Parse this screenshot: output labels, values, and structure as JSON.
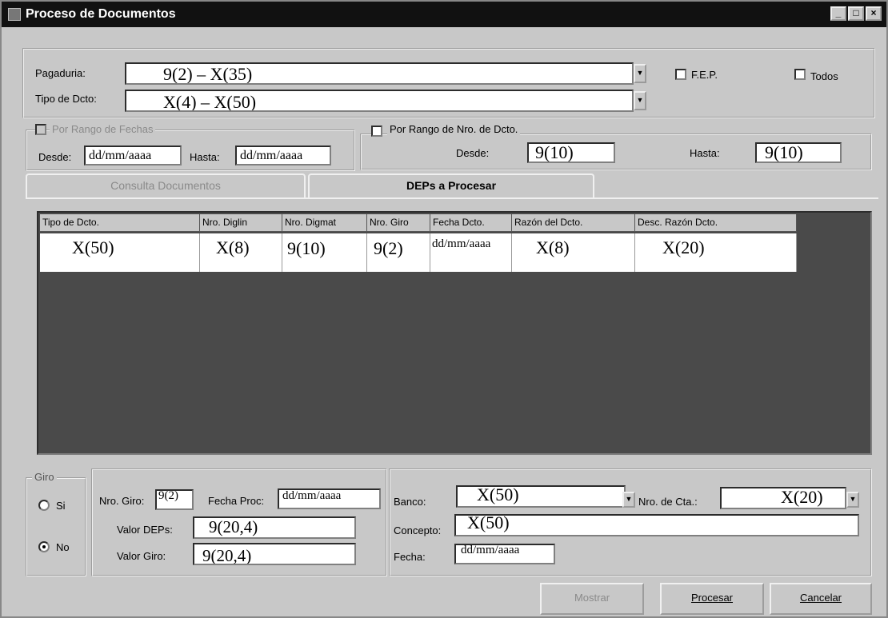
{
  "window": {
    "title": "Proceso de Documentos"
  },
  "header": {
    "pagaduria_label": "Pagaduria:",
    "pagaduria_value": "9(2) – X(35)",
    "tipo_label": "Tipo de Dcto:",
    "tipo_value": "X(4) – X(50)",
    "fep_label": "F.E.P.",
    "todos_label": "Todos"
  },
  "fechas": {
    "group_label": "Por Rango de Fechas",
    "desde_label": "Desde:",
    "desde_value": "dd/mm/aaaa",
    "hasta_label": "Hasta:",
    "hasta_value": "dd/mm/aaaa"
  },
  "nro": {
    "group_label": "Por Rango de Nro. de Dcto.",
    "desde_label": "Desde:",
    "desde_value": "9(10)",
    "hasta_label": "Hasta:",
    "hasta_value": "9(10)"
  },
  "tabs": [
    {
      "label": "Consulta Documentos"
    },
    {
      "label": "DEPs a Procesar"
    }
  ],
  "grid": {
    "columns": [
      "Tipo de Dcto.",
      "Nro. Diglin",
      "Nro. Digmat",
      "Nro. Giro",
      "Fecha Dcto.",
      "Razón del Dcto.",
      "Desc. Razón Dcto."
    ],
    "row": [
      "X(50)",
      "X(8)",
      "9(10)",
      "9(2)",
      "dd/mm/aaaa",
      "X(8)",
      "X(20)"
    ]
  },
  "giro": {
    "group_label": "Giro",
    "si_label": "Si",
    "no_label": "No"
  },
  "details": {
    "nro_giro_label": "Nro. Giro:",
    "nro_giro_value": "9(2)",
    "fecha_proc_label": "Fecha Proc:",
    "fecha_proc_value": "dd/mm/aaaa",
    "valor_deps_label": "Valor DEPs:",
    "valor_deps_value": "9(20,4)",
    "valor_giro_label": "Valor Giro:",
    "valor_giro_value": "9(20,4)"
  },
  "banco": {
    "banco_label": "Banco:",
    "banco_value": "X(50)",
    "cta_label": "Nro. de Cta.:",
    "cta_value": "X(20)",
    "concepto_label": "Concepto:",
    "concepto_value": "X(50)",
    "fecha_label": "Fecha:",
    "fecha_value": "dd/mm/aaaa"
  },
  "buttons": {
    "mostrar": "Mostrar",
    "procesar": "Procesar",
    "cancelar": "Cancelar"
  }
}
